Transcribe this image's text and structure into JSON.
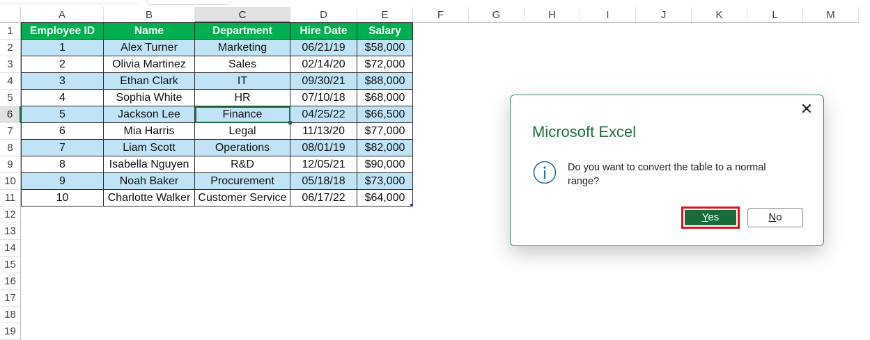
{
  "columns": [
    "A",
    "B",
    "C",
    "D",
    "E",
    "F",
    "G",
    "H",
    "I",
    "J",
    "K",
    "L",
    "M"
  ],
  "rows": [
    "1",
    "2",
    "3",
    "4",
    "5",
    "6",
    "7",
    "8",
    "9",
    "10",
    "11",
    "12",
    "13",
    "14",
    "15",
    "16",
    "17",
    "18",
    "19"
  ],
  "table": {
    "headers": [
      "Employee ID",
      "Name",
      "Department",
      "Hire Date",
      "Salary"
    ],
    "rows": [
      [
        "1",
        "Alex Turner",
        "Marketing",
        "06/21/19",
        "$58,000"
      ],
      [
        "2",
        "Olivia Martinez",
        "Sales",
        "02/14/20",
        "$72,000"
      ],
      [
        "3",
        "Ethan Clark",
        "IT",
        "09/30/21",
        "$88,000"
      ],
      [
        "4",
        "Sophia White",
        "HR",
        "07/10/18",
        "$68,000"
      ],
      [
        "5",
        "Jackson Lee",
        "Finance",
        "04/25/22",
        "$66,500"
      ],
      [
        "6",
        "Mia Harris",
        "Legal",
        "11/13/20",
        "$77,000"
      ],
      [
        "7",
        "Liam Scott",
        "Operations",
        "08/01/19",
        "$82,000"
      ],
      [
        "8",
        "Isabella Nguyen",
        "R&D",
        "12/05/21",
        "$90,000"
      ],
      [
        "9",
        "Noah Baker",
        "Procurement",
        "05/18/18",
        "$73,000"
      ],
      [
        "10",
        "Charlotte Walker",
        "Customer Service",
        "06/17/22",
        "$64,000"
      ]
    ]
  },
  "selection": {
    "column": "C",
    "row": "6"
  },
  "colors": {
    "header_fill": "#00b050",
    "band_fill": "#c0e4f5",
    "accent": "#1e7145",
    "highlight_box": "#e0101c"
  },
  "dialog": {
    "title": "Microsoft Excel",
    "message": "Do you want to convert the table to a normal range?",
    "icon": "info-icon",
    "close_icon": "close-icon",
    "close_glyph": "✕",
    "yes_label": "Yes",
    "yes_accel": "Y",
    "yes_rest": "es",
    "no_label": "No",
    "no_accel": "N",
    "no_rest": "o"
  }
}
